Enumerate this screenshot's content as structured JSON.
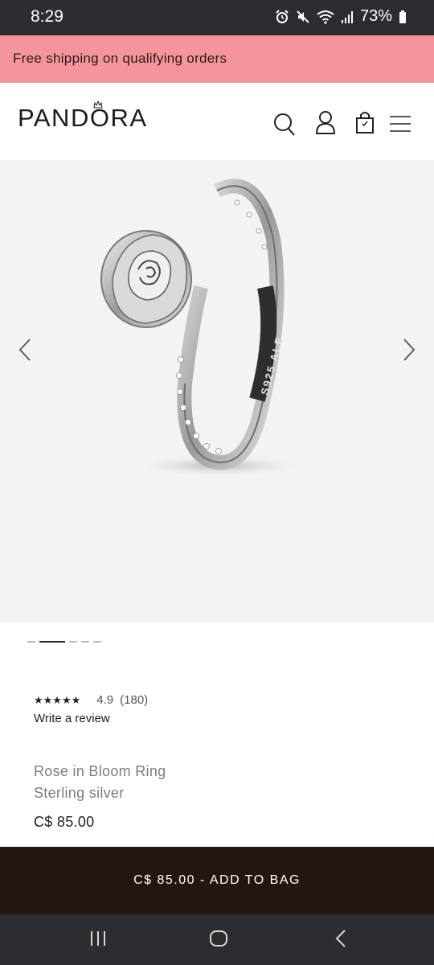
{
  "status_bar": {
    "time": "8:29",
    "battery": "73%",
    "icons": [
      "alarm-icon",
      "mute-icon",
      "wifi-icon",
      "signal-icon",
      "battery-icon"
    ]
  },
  "promo": {
    "text": "Free shipping on qualifying orders",
    "color": "#f4959b"
  },
  "header": {
    "logo": "PANDORA",
    "icons": [
      "search-icon",
      "account-icon",
      "bag-icon",
      "menu-icon"
    ]
  },
  "gallery": {
    "engraving": "S925 ALE",
    "slide_count": 5,
    "active_slide": 2
  },
  "rating": {
    "stars": "★★★★★",
    "value": "4.9",
    "count": "(180)",
    "write_review": "Write a review"
  },
  "product": {
    "name": "Rose in Bloom Ring",
    "material": "Sterling silver",
    "price": "C$ 85.00"
  },
  "cta": {
    "label": "C$ 85.00 - ADD TO BAG",
    "color": "#231611"
  },
  "nav": {
    "icons": [
      "recent-apps-icon",
      "home-icon",
      "back-icon"
    ]
  }
}
